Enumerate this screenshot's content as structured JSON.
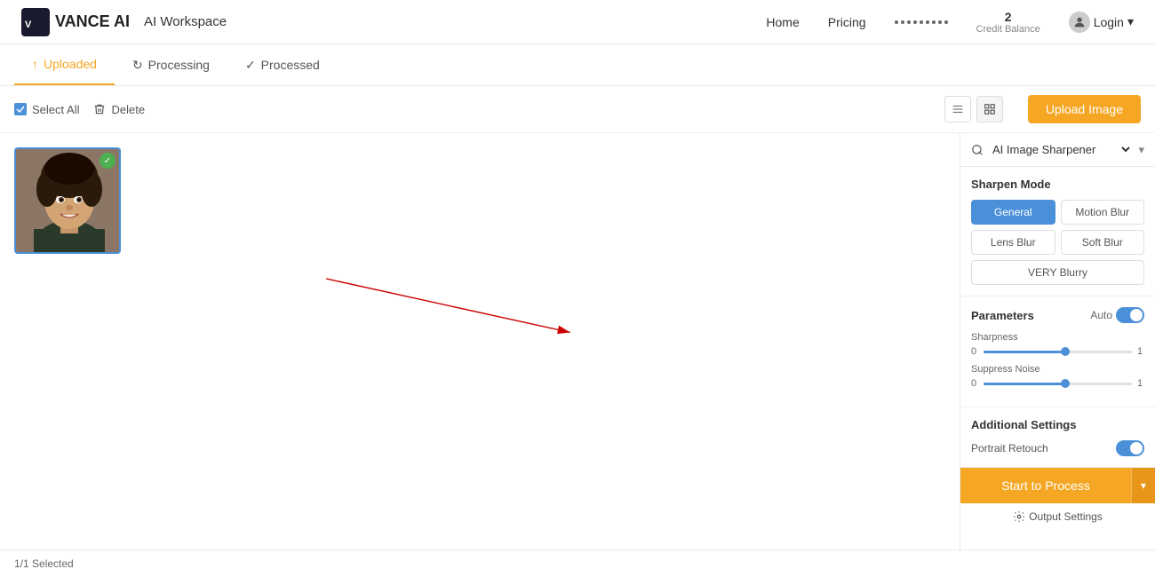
{
  "header": {
    "logo_text": "VANCE AI",
    "workspace_label": "AI Workspace",
    "nav": {
      "home": "Home",
      "pricing": "Pricing"
    },
    "credit": {
      "amount": "2",
      "label": "Credit Balance"
    },
    "login_label": "Login"
  },
  "tabs": [
    {
      "id": "uploaded",
      "label": "Uploaded",
      "icon": "↑",
      "active": true
    },
    {
      "id": "processing",
      "label": "Processing",
      "icon": "↻",
      "active": false
    },
    {
      "id": "processed",
      "label": "Processed",
      "icon": "✓",
      "active": false
    }
  ],
  "toolbar": {
    "select_all": "Select All",
    "delete": "Delete",
    "upload_btn": "Upload Image"
  },
  "status_bar": {
    "count": "1/1",
    "selected_label": "Selected"
  },
  "right_panel": {
    "tool_name": "AI Image Sharpener",
    "sharpen_mode": {
      "title": "Sharpen Mode",
      "modes": [
        {
          "label": "General",
          "active": true
        },
        {
          "label": "Motion Blur",
          "active": false
        },
        {
          "label": "Lens Blur",
          "active": false
        },
        {
          "label": "Soft Blur",
          "active": false
        },
        {
          "label": "VERY Blurry",
          "active": false,
          "full_width": true
        }
      ]
    },
    "parameters": {
      "title": "Parameters",
      "auto_label": "Auto",
      "sharpness": {
        "label": "Sharpness",
        "min": "0",
        "max": "1",
        "value_pct": 55
      },
      "suppress_noise": {
        "label": "Suppress Noise",
        "min": "0",
        "max": "1",
        "value_pct": 55
      }
    },
    "additional_settings": {
      "title": "Additional Settings",
      "portrait_retouch": "Portrait Retouch"
    },
    "process_btn": "Start to Process",
    "output_settings": "Output Settings"
  }
}
